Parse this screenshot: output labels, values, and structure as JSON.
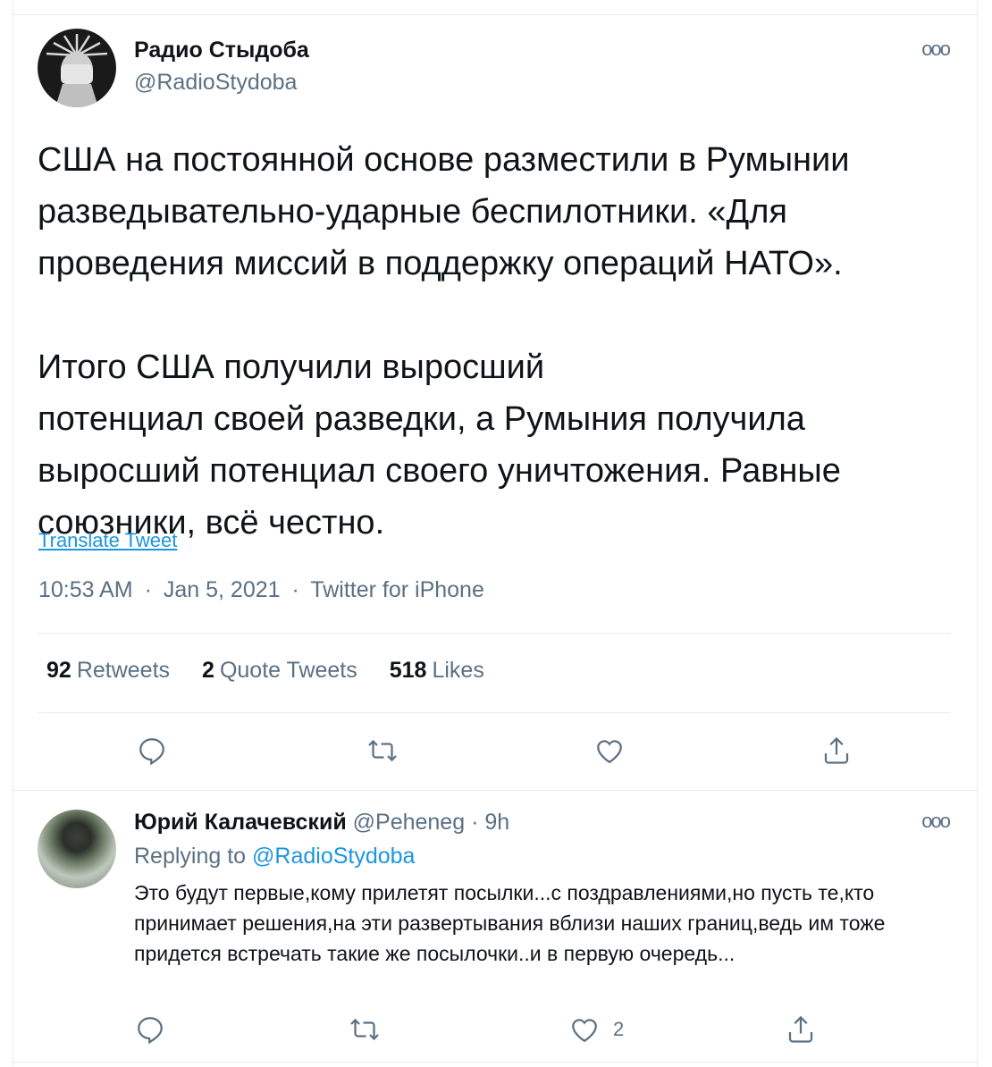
{
  "tweet": {
    "author_name": "Радио Стыдоба",
    "author_handle": "@RadioStydoba",
    "text_paragraph_1": "США на постоянной основе разместили в Румынии разведывательно-ударные беспилотники. «Для проведения миссий в поддержку операций НАТО».",
    "text_paragraph_2_line_1": "Итого США получили выросший",
    "text_paragraph_2_line_2": "потенциал своей разведки, а Румыния получила выросший потенциал своего уничтожения. Равные союзники, всё честно.",
    "translate_label": "Translate Tweet",
    "time": "10:53 AM",
    "date": "Jan 5, 2021",
    "source": "Twitter for iPhone",
    "dot": "·",
    "more_label": "ooo",
    "stats": {
      "retweets_count": "92",
      "retweets_label": "Retweets",
      "quotes_count": "2",
      "quotes_label": "Quote Tweets",
      "likes_count": "518",
      "likes_label": "Likes"
    }
  },
  "reply": {
    "author_name": "Юрий Калачевский",
    "author_handle": "@Peheneg",
    "dot": "·",
    "age": "9h",
    "replying_prefix": "Replying to",
    "replying_handle": "@RadioStydoba",
    "text": "Это будут первые,кому прилетят посылки...с поздравлениями,но пусть те,кто принимает решения,на эти развертывания вблизи наших границ,ведь им тоже придется встречать такие же посылочки..и в первую очередь...",
    "like_count": "2",
    "more_label": "ooo"
  },
  "icons": {
    "reply": "reply-icon",
    "retweet": "retweet-icon",
    "like": "heart-icon",
    "share": "share-icon"
  },
  "colors": {
    "link": "#1b95e0",
    "secondary_text": "#5b7083",
    "primary_text": "#0f1419",
    "divider": "#e6ecf0"
  }
}
